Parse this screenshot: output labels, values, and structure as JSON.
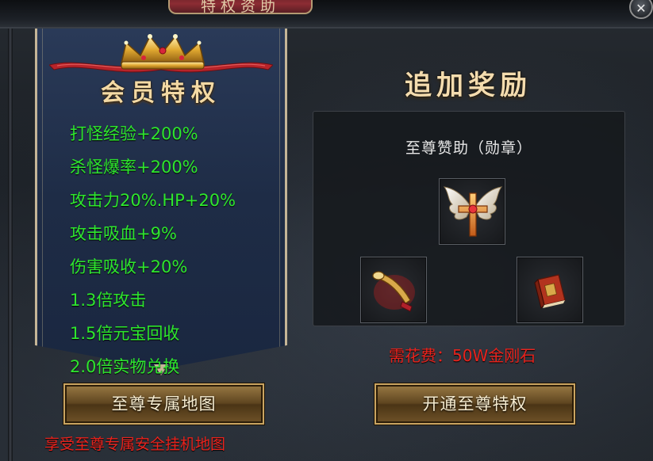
{
  "window": {
    "title": "特权资助",
    "close_glyph": "✕"
  },
  "member_banner": {
    "title": "会员特权",
    "perks": [
      "打怪经验+200%",
      "杀怪爆率+200%",
      "攻击力20%.HP+20%",
      "攻击吸血+9%",
      "伤害吸收+20%",
      "1.3倍攻击",
      "1.5倍元宝回收",
      "2.0倍实物兑换"
    ]
  },
  "map_button": {
    "label": "至尊专属地图",
    "note": "享受至尊专属安全挂机地图"
  },
  "bonus": {
    "title": "追加奖励",
    "caption": "至尊赞助（勋章）",
    "items": [
      {
        "icon": "winged-cross-medal-icon"
      },
      {
        "icon": "golden-horn-icon"
      },
      {
        "icon": "red-book-icon"
      }
    ],
    "cost": "需花费：50W金刚石"
  },
  "open_button": {
    "label": "开通至尊特权"
  },
  "colors": {
    "perk_text": "#2ee62e",
    "warning_text": "#e8231d",
    "title_gold": "#f3d9a4",
    "banner_blue": "#1e2c46"
  }
}
